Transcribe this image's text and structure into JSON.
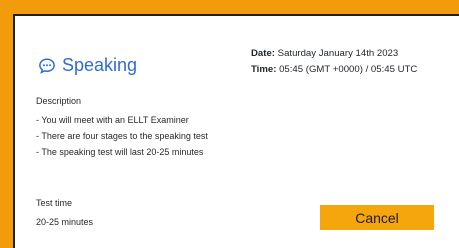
{
  "section_title": "Speaking",
  "meta": {
    "date_label": "Date:",
    "date_value": " Saturday January 14th 2023",
    "time_label": "Time:",
    "time_value": " 05:45 (GMT +0000) / 05:45 UTC"
  },
  "description": {
    "heading": "Description",
    "items": [
      "- You will meet with an ELLT Examiner",
      "- There are four stages to the speaking test",
      "- The speaking test will last 20-25 minutes"
    ]
  },
  "test_time": {
    "heading": "Test time",
    "value": "20-25 minutes"
  },
  "cancel_label": "Cancel",
  "colors": {
    "accent_blue": "#2f6bd3",
    "button_orange": "#f5a60c",
    "frame_orange": "#f39c0b"
  },
  "icons": {
    "speaking": "speech-bubble-icon"
  }
}
